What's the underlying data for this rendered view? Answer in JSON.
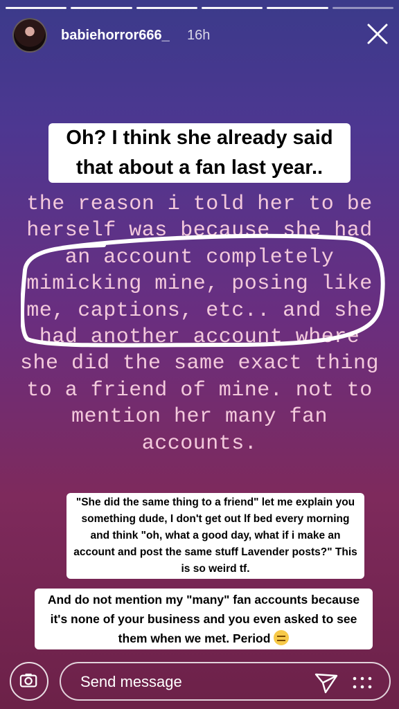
{
  "story": {
    "progress_segments": 6,
    "progress_active_index": 5
  },
  "header": {
    "username": "babiehorror666_",
    "timestamp": "16h",
    "close_icon": "close-icon"
  },
  "captions": {
    "top": "Oh? I think she already said that about a fan last year..",
    "middle": "\"She did the same thing to a friend\" let me explain you something dude, I don't get out lf bed every morning and think \"oh, what a good day, what if i make an account and post the same stuff Lavender posts?\" This is so weird tf.",
    "bottom": "And do not mention my \"many\" fan accounts because it's none of your business and you even asked to see them when we met. Period"
  },
  "screenshot_text": "the reason i told her to be herself was because she had an account completely mimicking mine, posing like me, captions, etc.. and she had another account where she did the same exact thing to a friend of mine. not to mention her many fan accounts.",
  "footer": {
    "message_placeholder": "Send message",
    "camera_icon": "camera-icon",
    "send_icon": "send-icon",
    "more_icon": "more-icon"
  },
  "colors": {
    "accent_text": "#f3c9dc",
    "gradient_top": "#3b3a8a",
    "gradient_bottom": "#6c2148"
  }
}
